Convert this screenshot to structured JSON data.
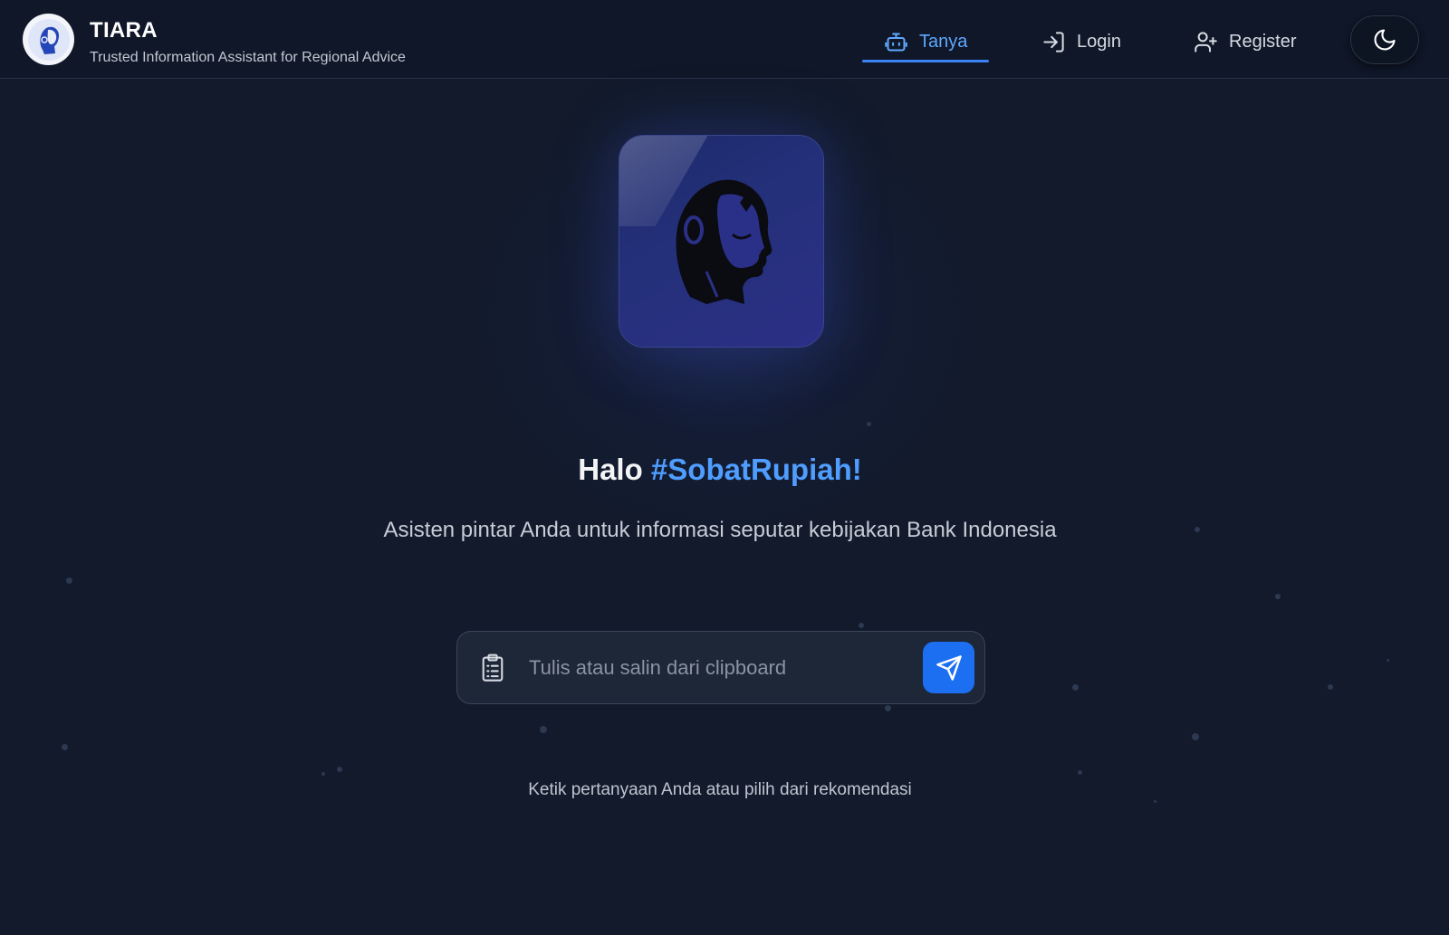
{
  "app": {
    "title": "TIARA",
    "subtitle": "Trusted Information Assistant for Regional Advice"
  },
  "nav": {
    "items": [
      {
        "label": "Tanya",
        "icon": "robot-icon",
        "active": true
      },
      {
        "label": "Login",
        "icon": "login-icon",
        "active": false
      },
      {
        "label": "Register",
        "icon": "user-plus-icon",
        "active": false
      }
    ],
    "theme_toggle_icon": "moon-icon"
  },
  "hero": {
    "greeting_prefix": "Halo",
    "greeting_accent": "#SobatRupiah!",
    "tagline": "Asisten pintar Anda untuk informasi seputar kebijakan Bank Indonesia"
  },
  "chat": {
    "placeholder": "Tulis atau salin dari clipboard",
    "value": "",
    "clipboard_icon": "clipboard-icon",
    "send_icon": "send-icon",
    "hint": "Ketik pertanyaan Anda atau pilih dari rekomendasi"
  },
  "colors": {
    "background": "#121a2b",
    "header": "#0f1728",
    "accent": "#4f9dff",
    "send_button": "#1d6ff2",
    "avatar_card": "#24307a"
  }
}
